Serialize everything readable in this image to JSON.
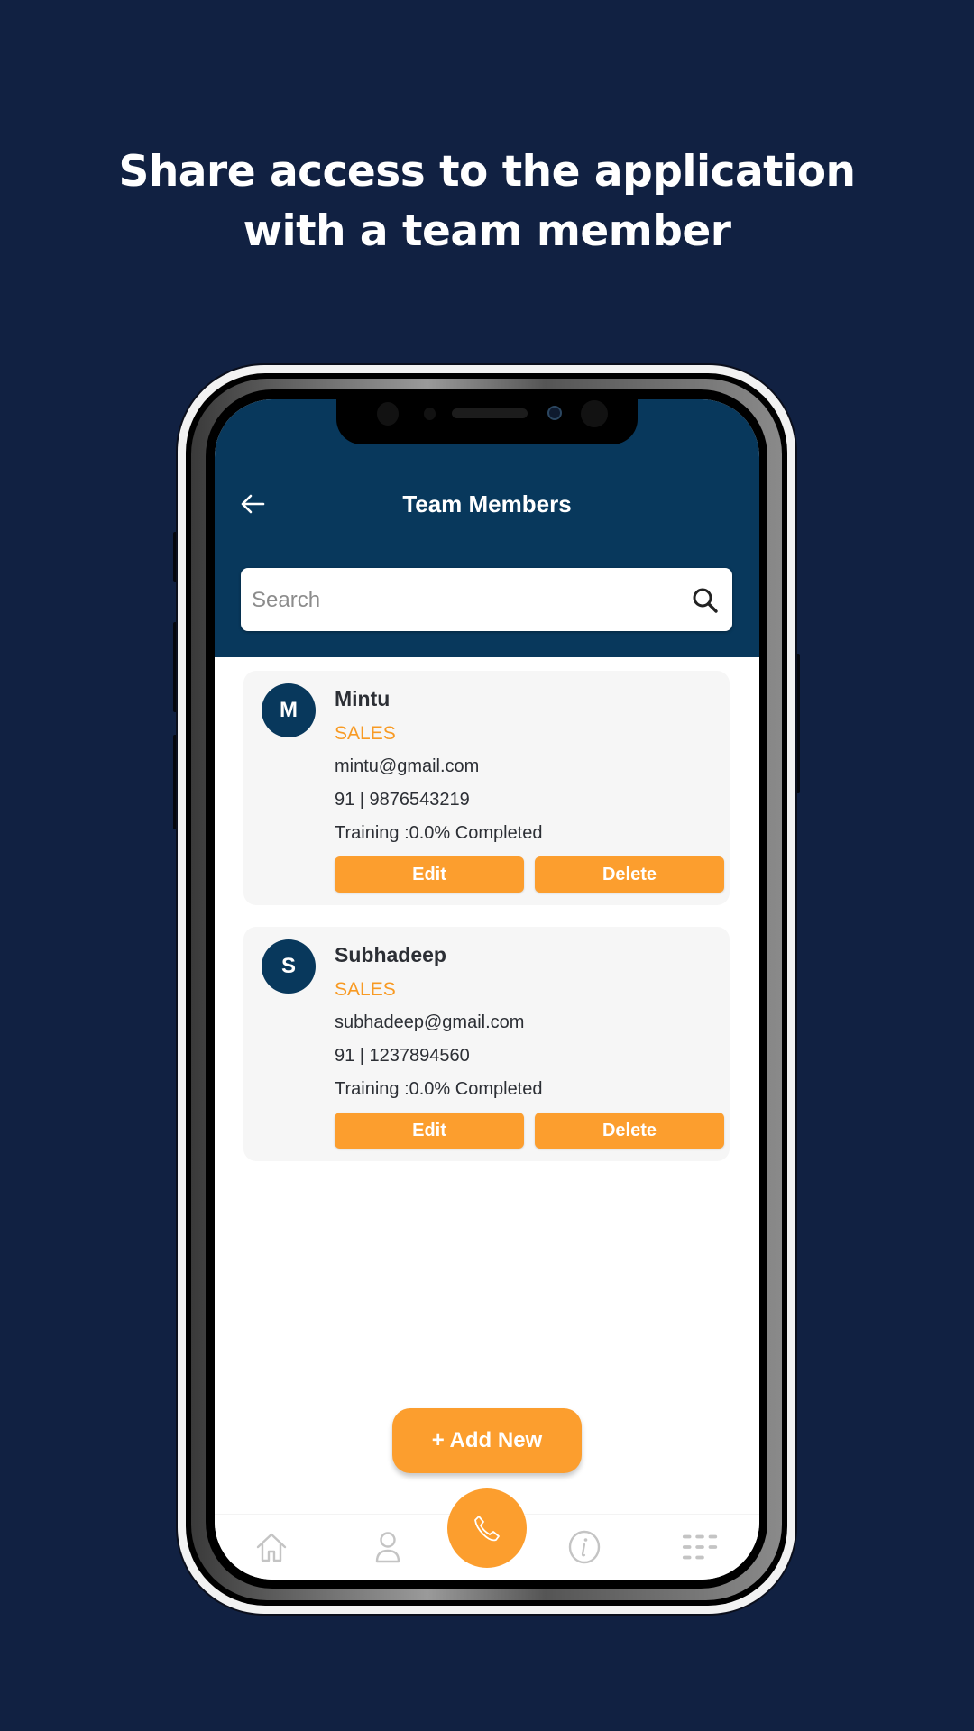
{
  "headline": {
    "line1": "Share access to the application",
    "line2": "with a team member"
  },
  "app": {
    "title": "Team Members",
    "back_icon": "arrow-left-icon",
    "search": {
      "placeholder": "Search",
      "value": "",
      "icon": "search-icon"
    },
    "members": [
      {
        "initial": "M",
        "name": "Mintu",
        "role": "SALES",
        "email": "mintu@gmail.com",
        "phone": "91 | 9876543219",
        "training": "Training :0.0% Completed",
        "edit_label": "Edit",
        "delete_label": "Delete"
      },
      {
        "initial": "S",
        "name": "Subhadeep",
        "role": "SALES",
        "email": "subhadeep@gmail.com",
        "phone": "91 | 1237894560",
        "training": "Training :0.0% Completed",
        "edit_label": "Edit",
        "delete_label": "Delete"
      }
    ],
    "add_new_label": "+ Add New",
    "nav": [
      {
        "icon": "home-icon"
      },
      {
        "icon": "user-icon"
      },
      {
        "icon": "phone-call-icon"
      },
      {
        "icon": "info-icon"
      },
      {
        "icon": "grid-menu-icon"
      }
    ]
  },
  "colors": {
    "background": "#112142",
    "header": "#08385c",
    "accent": "#fc9e2e",
    "role_text": "#f89a23",
    "card_bg": "#f6f6f6"
  }
}
